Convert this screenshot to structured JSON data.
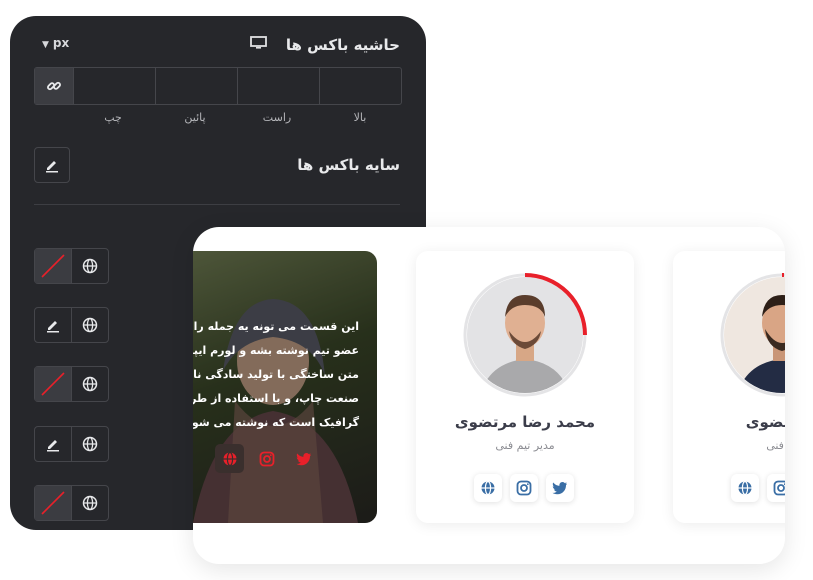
{
  "panel": {
    "border_title": "حاشیه باکس ها",
    "unit": "px",
    "sides": [
      "بالا",
      "راست",
      "پائین",
      "چپ"
    ],
    "shadow_title": "سایه باکس ها"
  },
  "colors": {
    "panel_bg": "#26272b",
    "accent_red": "#e8202a",
    "twitter": "#3a6ea5"
  },
  "preview": {
    "photo_card": {
      "lines": [
        "این قسمت می تونه یه جمله راجع",
        "عضو تیم نوشته بشه و لورم ایپسو",
        "متن ساختگی با تولید سادگی نامفهو",
        "صنعت چاپ، و با استفاده از طراحا",
        "گرافیک است که نوشته می شود."
      ]
    },
    "member": {
      "name": "محمد رضا مرتضوی",
      "role": "مدیر تیم فنی"
    },
    "member_partial": {
      "name": "ا مرتضوی",
      "role": "یم فنی"
    }
  }
}
